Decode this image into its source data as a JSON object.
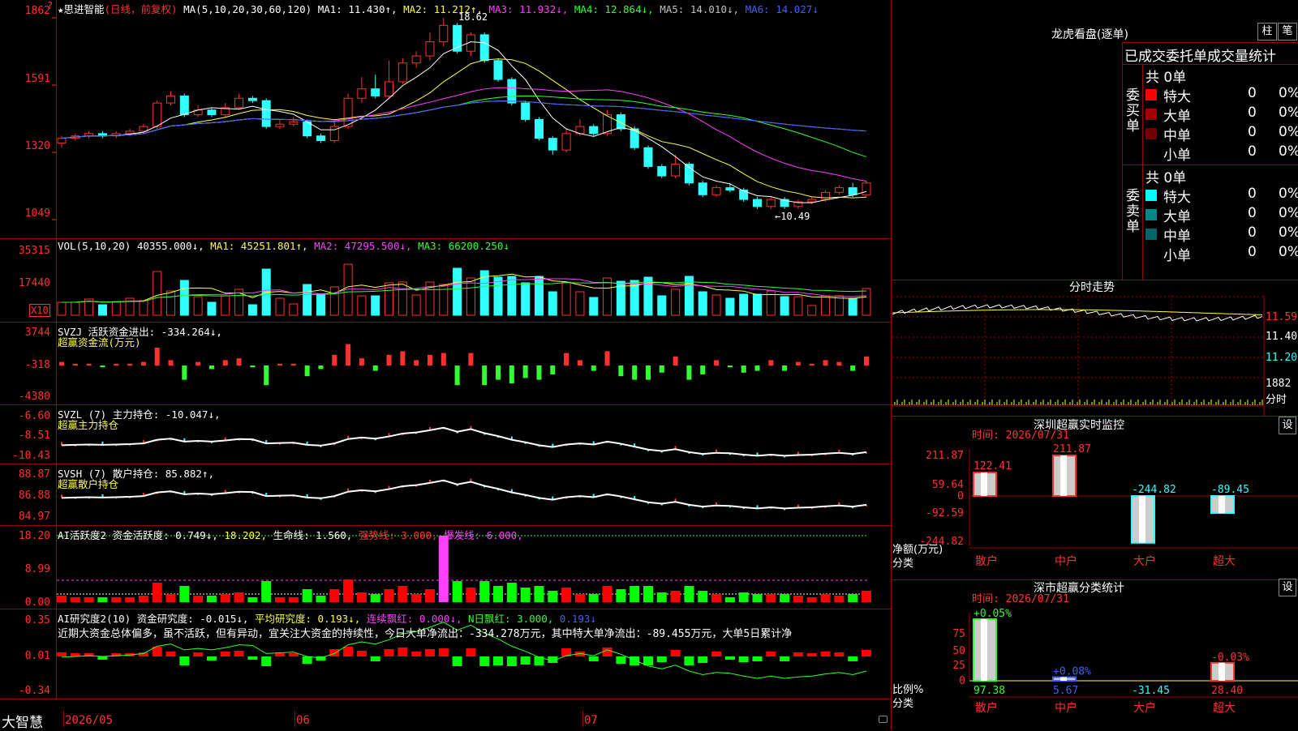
{
  "main_chart": {
    "stock_name": "★思进智能",
    "period": "(日线，前复权)",
    "ma_label": "MA(5,10,20,30,60,120)",
    "ma": [
      {
        "label": "MA1: 11.430↑,",
        "color": "#ffffff"
      },
      {
        "label": "MA2: 11.212↑,",
        "color": "#ffff40"
      },
      {
        "label": "MA3: 11.932↓,",
        "color": "#ff40ff"
      },
      {
        "label": "MA4: 12.864↓,",
        "color": "#30ff30"
      },
      {
        "label": "MA5: 14.010↓,",
        "color": "#c0c0c0"
      },
      {
        "label": "MA6: 14.027↓",
        "color": "#4060ff"
      }
    ],
    "y_labels": [
      "1862",
      "1591",
      "1320",
      "1049"
    ],
    "high_label": "18.62",
    "low_label": "←10.49",
    "candles": [
      [
        13.3,
        13.5,
        13.1,
        13.6
      ],
      [
        13.5,
        13.6,
        13.4,
        13.7
      ],
      [
        13.6,
        13.7,
        13.5,
        13.8
      ],
      [
        13.7,
        13.6,
        13.5,
        13.8
      ],
      [
        13.6,
        13.7,
        13.5,
        13.8
      ],
      [
        13.7,
        13.8,
        13.6,
        13.9
      ],
      [
        13.8,
        14.0,
        13.7,
        14.1
      ],
      [
        14.0,
        15.0,
        13.9,
        15.1
      ],
      [
        15.0,
        15.3,
        14.9,
        15.5
      ],
      [
        15.3,
        14.5,
        14.4,
        15.4
      ],
      [
        14.5,
        14.7,
        14.4,
        14.9
      ],
      [
        14.7,
        14.5,
        14.4,
        14.8
      ],
      [
        14.5,
        14.8,
        14.4,
        15.0
      ],
      [
        14.8,
        15.2,
        14.7,
        15.4
      ],
      [
        15.2,
        15.1,
        15.0,
        15.3
      ],
      [
        15.1,
        14.0,
        13.9,
        15.2
      ],
      [
        14.0,
        14.1,
        13.9,
        14.3
      ],
      [
        14.1,
        14.2,
        14.0,
        14.4
      ],
      [
        14.2,
        13.6,
        13.5,
        14.3
      ],
      [
        13.6,
        13.4,
        13.3,
        13.7
      ],
      [
        13.4,
        14.0,
        13.3,
        14.2
      ],
      [
        14.0,
        15.2,
        13.9,
        15.4
      ],
      [
        15.2,
        15.6,
        15.0,
        16.1
      ],
      [
        15.6,
        15.3,
        15.2,
        16.2
      ],
      [
        15.3,
        15.9,
        15.2,
        16.8
      ],
      [
        15.9,
        16.7,
        15.8,
        16.9
      ],
      [
        16.7,
        17.0,
        16.5,
        17.2
      ],
      [
        17.0,
        17.6,
        16.8,
        18.0
      ],
      [
        17.6,
        18.3,
        17.4,
        18.62
      ],
      [
        18.3,
        17.2,
        17.1,
        18.4
      ],
      [
        17.2,
        17.9,
        17.0,
        18.0
      ],
      [
        17.9,
        16.8,
        16.7,
        18.0
      ],
      [
        16.8,
        16.0,
        15.9,
        16.9
      ],
      [
        16.0,
        15.0,
        14.9,
        16.1
      ],
      [
        15.0,
        14.3,
        14.2,
        15.1
      ],
      [
        14.3,
        13.5,
        13.4,
        14.4
      ],
      [
        13.5,
        13.0,
        12.8,
        13.6
      ],
      [
        13.0,
        13.7,
        12.9,
        13.9
      ],
      [
        13.7,
        14.0,
        13.6,
        14.3
      ],
      [
        14.0,
        13.7,
        13.6,
        14.1
      ],
      [
        13.7,
        14.5,
        13.6,
        14.7
      ],
      [
        14.5,
        13.9,
        13.8,
        14.6
      ],
      [
        13.9,
        13.1,
        13.0,
        14.0
      ],
      [
        13.1,
        12.3,
        12.2,
        13.2
      ],
      [
        12.3,
        11.9,
        11.8,
        12.4
      ],
      [
        11.9,
        12.4,
        11.8,
        12.8
      ],
      [
        12.4,
        11.6,
        11.5,
        12.5
      ],
      [
        11.6,
        11.1,
        11.0,
        11.7
      ],
      [
        11.1,
        11.4,
        11.0,
        11.5
      ],
      [
        11.4,
        11.3,
        11.2,
        11.6
      ],
      [
        11.3,
        10.9,
        10.8,
        11.4
      ],
      [
        10.9,
        10.6,
        10.49,
        11.0
      ],
      [
        10.6,
        10.9,
        10.5,
        11.0
      ],
      [
        10.9,
        10.6,
        10.5,
        11.0
      ],
      [
        10.6,
        10.8,
        10.5,
        10.9
      ],
      [
        10.8,
        10.9,
        10.7,
        11.0
      ],
      [
        10.9,
        11.2,
        10.8,
        11.3
      ],
      [
        11.2,
        11.4,
        11.1,
        11.5
      ],
      [
        11.4,
        11.1,
        11.0,
        11.6
      ],
      [
        11.1,
        11.6,
        11.0,
        11.7
      ]
    ]
  },
  "vol": {
    "header": "VOL(5,10,20)",
    "value": "40355.000↓,",
    "ma1": "MA1: 45251.801↑,",
    "ma2": "MA2: 47295.500↓,",
    "ma3": "MA3: 66200.250↓",
    "y_labels": [
      "35315",
      "17440",
      "X10"
    ]
  },
  "svzj": {
    "header": "SVZJ  活跃资金进出: -334.264↓,",
    "sub": "超赢资金流(万元)",
    "y_labels": [
      "3744",
      "-318",
      "-4380"
    ]
  },
  "svzl": {
    "header": "SVZL (7) 主力持仓: -10.047↓,",
    "sub": "超赢主力持仓",
    "y_labels": [
      "-6.60",
      "-8.51",
      "-10.43"
    ]
  },
  "svsh": {
    "header": "SVSH (7) 散户持仓: 85.882↑,",
    "sub": "超赢散户持仓",
    "y_labels": [
      "88.87",
      "86.88",
      "84.97"
    ]
  },
  "ai_active": {
    "header": "AI活跃度2 资金活跃度: 0.749↓,",
    "v2": "18.202,",
    "v3": "生命线: 1.560,",
    "v4": "强势线: 3.000,",
    "v5": "爆发线: 6.000,",
    "y_labels": [
      "18.20",
      "8.99",
      "0.00"
    ]
  },
  "ai_research": {
    "header": "AI研究度2(10) 资金研究度: -0.015↓,",
    "v2": "平均研究度: 0.193↓,",
    "v3": "连续飘红: 0.000↓,",
    "v4": "N日飘红: 3.000,",
    "v5": "0.193↓",
    "text": "近期大资金总体偏多，虽不活跃，但有异动，宜关注大资金的持续性，今日大单净流出：-334.278万元，其中特大单净流出：-89.455万元，大单5日累计净",
    "y_labels": [
      "0.35",
      "0.01",
      "-0.34"
    ]
  },
  "x_axis": {
    "brand": "大智慧",
    "labels": [
      "2026/05",
      "06",
      "07"
    ]
  },
  "right_panel": {
    "lhb_title": "龙虎看盘(逐单)",
    "btn_zhu": "柱",
    "btn_bi": "笔",
    "stats_title": "已成交委托单成交量统计",
    "buy_label": "委买单",
    "sell_label": "委卖单",
    "buy_total": "共 0单",
    "sell_total": "共 0单",
    "buy_rows": [
      {
        "name": "特大",
        "val": "0",
        "pct": "0%",
        "color": "#ff0000"
      },
      {
        "name": "大单",
        "val": "0",
        "pct": "0%",
        "color": "#a00000"
      },
      {
        "name": "中单",
        "val": "0",
        "pct": "0%",
        "color": "#700000"
      },
      {
        "name": "小单",
        "val": "0",
        "pct": "0%",
        "color": "#000000"
      }
    ],
    "sell_rows": [
      {
        "name": "特大",
        "val": "0",
        "pct": "0%",
        "color": "#00ffff"
      },
      {
        "name": "大单",
        "val": "0",
        "pct": "0%",
        "color": "#008888"
      },
      {
        "name": "中单",
        "val": "0",
        "pct": "0%",
        "color": "#006666"
      },
      {
        "name": "小单",
        "val": "0",
        "pct": "0%",
        "color": "#000000"
      }
    ],
    "intraday_title": "分时走势",
    "intraday_y": [
      "11.59",
      "11.40",
      "11.20",
      "1882",
      "分时"
    ],
    "sz_monitor_title": "深圳超赢实时监控",
    "sz_time": "时间: 2026/07/31",
    "sz_y": [
      "211.87",
      "59.64",
      "0",
      "-92.59",
      "-244.82"
    ],
    "sz_bars": [
      {
        "cat": "散户",
        "value": 122.41,
        "label": "122.41"
      },
      {
        "cat": "中户",
        "value": 211.87,
        "label": "211.87"
      },
      {
        "cat": "大户",
        "value": -244.82,
        "label": "-244.82"
      },
      {
        "cat": "超大",
        "value": -89.45,
        "label": "-89.45"
      }
    ],
    "sz_unit": "净额(万元)",
    "sz_cat_label": "分类",
    "sz_stat_title": "深市超赢分类统计",
    "sz_stat_time": "时间: 2026/07/31",
    "stat_y": [
      "75",
      "50",
      "25",
      "0"
    ],
    "stat_bars": [
      {
        "cat": "散户",
        "pct_label": "+0.05%",
        "height": 97.38,
        "bottom": "97.38",
        "color": "#30ff30"
      },
      {
        "cat": "中户",
        "pct_label": "+0.08%",
        "height": 5.67,
        "bottom": "5.67",
        "color": "#4060ff"
      },
      {
        "cat": "大户",
        "pct_label": "",
        "height": 0,
        "bottom": "-31.45",
        "color": "#30ffff"
      },
      {
        "cat": "超大",
        "pct_label": "-0.03%",
        "height": 28.4,
        "bottom": "28.40",
        "color": "#ff3333"
      }
    ],
    "stat_unit": "比例%",
    "stat_cat_label": "分类",
    "set_label": "设"
  }
}
